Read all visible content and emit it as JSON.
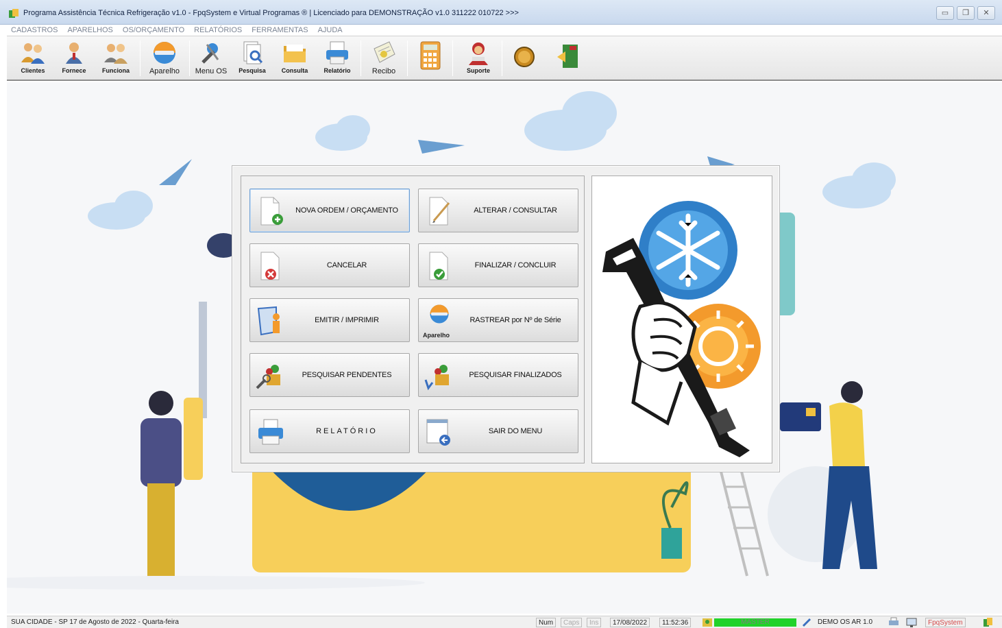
{
  "window": {
    "title": "Programa Assistência Técnica Refrigeração v1.0 - FpqSystem e Virtual Programas ® | Licenciado para  DEMONSTRAÇÃO v1.0 311222 010722 >>>",
    "buttons": {
      "minimize": "▭",
      "restore": "❐",
      "close": "✕"
    }
  },
  "menubar": [
    "CADASTROS",
    "APARELHOS",
    "OS/ORÇAMENTO",
    "RELATÓRIOS",
    "FERRAMENTAS",
    "AJUDA"
  ],
  "toolbar": {
    "clientes": "Clientes",
    "fornece": "Fornece",
    "funciona": "Funciona",
    "aparelho": "Aparelho",
    "menu_os": "Menu OS",
    "pesquisa": "Pesquisa",
    "consulta": "Consulta",
    "relatorio": "Relatório",
    "recibo": "Recibo",
    "suporte": "Suporte"
  },
  "dialog": {
    "nova_ordem": "NOVA ORDEM / ORÇAMENTO",
    "alterar": "ALTERAR  /  CONSULTAR",
    "cancelar": "CANCELAR",
    "finalizar": "FINALIZAR  /  CONCLUIR",
    "emitir": "EMITIR  /  IMPRIMIR",
    "rastrear": "RASTREAR por Nº de Série",
    "rastrear_sub": "Aparelho",
    "pesq_pendentes": "PESQUISAR PENDENTES",
    "pesq_finalizados": "PESQUISAR FINALIZADOS",
    "relatorio": "RELATÓRIO",
    "sair": "SAIR DO MENU"
  },
  "statusbar": {
    "left": "SUA CIDADE - SP 17 de Agosto de 2022 - Quarta-feira",
    "num": "Num",
    "caps": "Caps",
    "ins": "Ins",
    "date": "17/08/2022",
    "time": "11:52:36",
    "master": "MASTER",
    "demo": "DEMO OS AR 1.0",
    "brand": "FpqSystem"
  },
  "colors": {
    "accent_blue": "#2f7fc8",
    "yellow": "#f7cf5a",
    "status_green": "#22d22a"
  }
}
